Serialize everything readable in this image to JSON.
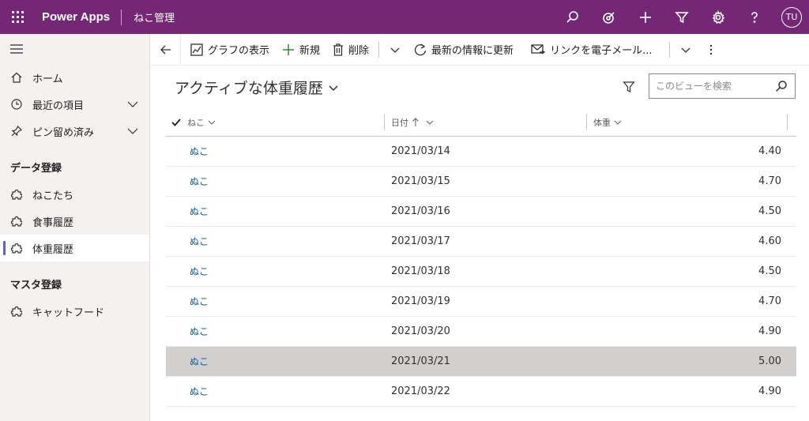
{
  "topbar": {
    "brand": "Power Apps",
    "app_name": "ねこ管理",
    "user_initials": "TU",
    "icons": [
      "search-icon",
      "target-icon",
      "plus-icon",
      "filter-icon",
      "gear-icon",
      "help-icon"
    ]
  },
  "sidebar": {
    "nav": [
      {
        "label": "ホーム",
        "icon": "home-icon"
      },
      {
        "label": "最近の項目",
        "icon": "clock-icon",
        "expandable": true
      },
      {
        "label": "ピン留め済み",
        "icon": "pin-icon",
        "expandable": true
      }
    ],
    "groups": [
      {
        "title": "データ登録",
        "items": [
          {
            "label": "ねこたち",
            "icon": "puzzle-icon"
          },
          {
            "label": "食事履歴",
            "icon": "puzzle-icon"
          },
          {
            "label": "体重履歴",
            "icon": "puzzle-icon",
            "active": true
          }
        ]
      },
      {
        "title": "マスタ登録",
        "items": [
          {
            "label": "キャットフード",
            "icon": "puzzle-icon"
          }
        ]
      }
    ]
  },
  "commands": {
    "show_chart": "グラフの表示",
    "new": "新規",
    "delete": "削除",
    "refresh": "最新の情報に更新",
    "email_link": "リンクを電子メール..."
  },
  "view": {
    "title": "アクティブな体重履歴",
    "search_placeholder": "このビューを検索"
  },
  "grid": {
    "columns": {
      "name": "ねこ",
      "date": "日付",
      "weight": "体重"
    },
    "sort": {
      "column": "date",
      "direction": "ascending"
    },
    "rows": [
      {
        "name": "ぬこ",
        "date": "2021/03/14",
        "weight": "4.40"
      },
      {
        "name": "ぬこ",
        "date": "2021/03/15",
        "weight": "4.70"
      },
      {
        "name": "ぬこ",
        "date": "2021/03/16",
        "weight": "4.50"
      },
      {
        "name": "ぬこ",
        "date": "2021/03/17",
        "weight": "4.60"
      },
      {
        "name": "ぬこ",
        "date": "2021/03/18",
        "weight": "4.50"
      },
      {
        "name": "ぬこ",
        "date": "2021/03/19",
        "weight": "4.70"
      },
      {
        "name": "ぬこ",
        "date": "2021/03/20",
        "weight": "4.90"
      },
      {
        "name": "ぬこ",
        "date": "2021/03/21",
        "weight": "5.00",
        "selected": true
      },
      {
        "name": "ぬこ",
        "date": "2021/03/22",
        "weight": "4.90"
      }
    ]
  },
  "colors": {
    "topbar": "#742774",
    "accent": "#6264a7",
    "link": "#115ea3",
    "selected_row": "#d2d0ce"
  }
}
